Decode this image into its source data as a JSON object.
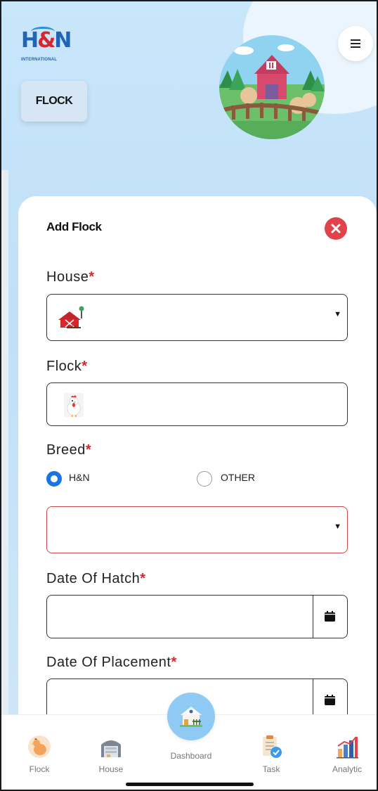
{
  "header": {
    "logo_text_h": "H",
    "logo_text_amp": "&",
    "logo_text_n": "N",
    "logo_subtext": "INTERNATIONAL",
    "section_tag": "FLOCK",
    "menu_icon": "hamburger-menu-icon"
  },
  "form": {
    "title": "Add Flock",
    "close_icon": "close-icon",
    "required_mark": "*",
    "house": {
      "label": "House"
    },
    "flock": {
      "label": "Flock",
      "value": ""
    },
    "breed": {
      "label": "Breed",
      "options": [
        {
          "label": "H&N",
          "checked": true
        },
        {
          "label": "OTHER",
          "checked": false
        }
      ],
      "selected_value": ""
    },
    "date_of_hatch": {
      "label": "Date Of Hatch",
      "value": ""
    },
    "date_of_placement": {
      "label": "Date Of Placement",
      "value": ""
    }
  },
  "bottom_nav": {
    "items": [
      {
        "label": "Flock",
        "icon": "chicken-icon"
      },
      {
        "label": "House",
        "icon": "barn-icon"
      },
      {
        "label": "Dashboard",
        "icon": "farmhouse-icon"
      },
      {
        "label": "Task",
        "icon": "clipboard-check-icon"
      },
      {
        "label": "Analytic",
        "icon": "bar-chart-icon"
      }
    ]
  },
  "colors": {
    "accent_blue": "#1b74e4",
    "required_red": "#d8262d",
    "close_red": "#e2434a",
    "error_border": "#c9484c",
    "background_blue": "#c9e6fa"
  }
}
